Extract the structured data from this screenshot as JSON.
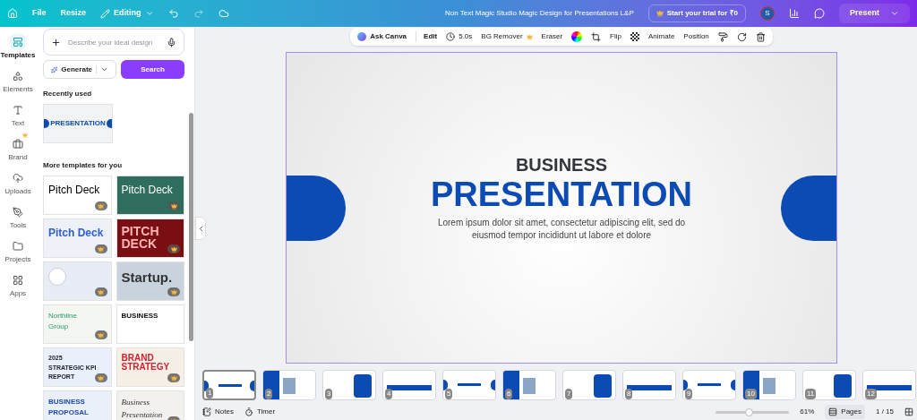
{
  "top_bar": {
    "menu": [
      "File",
      "Resize"
    ],
    "mode": "Editing",
    "title": "Non Text Magic Studio Magic Design for Presentations L&P",
    "trial": "Start your trial for ₹0",
    "avatar": "S",
    "present": "Present"
  },
  "rail": [
    {
      "label": "Templates",
      "selected": true,
      "premium": false
    },
    {
      "label": "Elements",
      "selected": false,
      "premium": false
    },
    {
      "label": "Text",
      "selected": false,
      "premium": false
    },
    {
      "label": "Brand",
      "selected": false,
      "premium": true
    },
    {
      "label": "Uploads",
      "selected": false,
      "premium": false
    },
    {
      "label": "Tools",
      "selected": false,
      "premium": false
    },
    {
      "label": "Projects",
      "selected": false,
      "premium": false
    },
    {
      "label": "Apps",
      "selected": false,
      "premium": false
    }
  ],
  "panel": {
    "search": {
      "placeholder": "Describe your ideal design"
    },
    "generate": "Generate",
    "search_button": "Search",
    "recent_heading": "Recently used",
    "recent": [
      {
        "title": "PRESENTATION"
      }
    ],
    "more_heading": "More templates for you",
    "templates": [
      {
        "title": "Pitch Deck",
        "premium": true
      },
      {
        "title": "Pitch Deck",
        "premium": true
      },
      {
        "title": "Pitch Deck",
        "premium": true
      },
      {
        "title": "PITCH DECK",
        "premium": true
      },
      {
        "premium": true
      },
      {
        "title": "Startup.",
        "premium": true
      },
      {
        "title": "Northline Group",
        "premium": true
      },
      {
        "title": "BUSINESS",
        "premium": false
      },
      {
        "title": "2025 STRATEGIC KPI REPORT",
        "premium": true
      },
      {
        "title": "BRAND STRATEGY",
        "premium": true
      },
      {
        "title": "BUSINESS PROPOSAL",
        "premium": false
      },
      {
        "title": "Business Presentation",
        "premium": true
      }
    ]
  },
  "toolbar": [
    "Ask Canva",
    "Edit",
    "5.0s",
    "BG Remover",
    "Eraser",
    "Flip",
    "Animate",
    "Position"
  ],
  "slide": {
    "kicker": "BUSINESS",
    "title": "PRESENTATION",
    "body": "Lorem ipsum dolor sit amet, consectetur adipiscing elit, sed do eiusmod tempor incididunt ut labore et dolore"
  },
  "pages": [
    {
      "number": "1",
      "selected": true
    },
    {
      "number": "2",
      "selected": false
    },
    {
      "number": "3",
      "selected": false
    },
    {
      "number": "4",
      "selected": false
    },
    {
      "number": "5",
      "selected": false
    },
    {
      "number": "6",
      "selected": false
    },
    {
      "number": "7",
      "selected": false
    },
    {
      "number": "8",
      "selected": false
    },
    {
      "number": "9",
      "selected": false
    },
    {
      "number": "10",
      "selected": false
    },
    {
      "number": "11",
      "selected": false
    },
    {
      "number": "12",
      "selected": false
    }
  ],
  "bottom_bar": {
    "notes": "Notes",
    "timer": "Timer",
    "zoom": {
      "level": 0.45
    },
    "zoom_reading": "61%",
    "pages": "Pages",
    "page_count": "1 / 15"
  }
}
